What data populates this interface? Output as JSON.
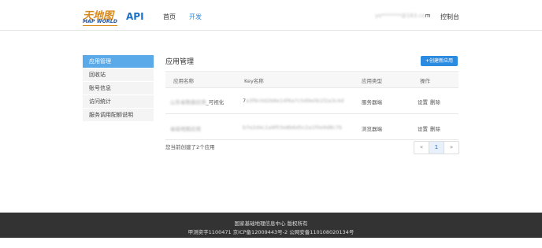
{
  "header": {
    "logo_cn": "天地图",
    "logo_en": "MAP WORLD",
    "api": "API",
    "nav": {
      "home": "首页",
      "dev": "开发"
    },
    "user_email_prefix": "yo*******@",
    "user_email_blur": "163.co",
    "user_email_suffix": "m",
    "console": "控制台"
  },
  "sidebar": {
    "items": [
      {
        "label": "应用管理"
      },
      {
        "label": "回收站"
      },
      {
        "label": "账号信息"
      },
      {
        "label": "访问统计"
      },
      {
        "label": "服务调用配额说明"
      }
    ]
  },
  "main": {
    "title": "应用管理",
    "create_button": "+创建新应用",
    "columns": [
      "应用名称",
      "Key名称",
      "应用类型",
      "操作"
    ],
    "rows": [
      {
        "name_blur": "山东省数据应用",
        "name_tail": "_可视化",
        "key_prefix": "7",
        "key_blur": "a3f9c0d2b8e14f6a7c5d9e0b1f2a3c4d",
        "type": "服务器端",
        "op_settings": "设置",
        "op_delete": "删除"
      },
      {
        "name_blur": "省级地图应用",
        "name_tail": "",
        "key_prefix": "",
        "key_blur": "b7e2d4c1a9f03e8b6d5c2a1f0e9d8c7b",
        "type": "浏览器端",
        "op_settings": "设置",
        "op_delete": "删除"
      }
    ],
    "summary": "您当前创建了2个应用",
    "pager": {
      "prev": "«",
      "current": "1",
      "next": "»"
    }
  },
  "footer": {
    "line1": "国家基础地理信息中心 版权所有",
    "line2": "甲测资字1100471  京ICP备12009443号-2  公网安备110108020134号"
  }
}
